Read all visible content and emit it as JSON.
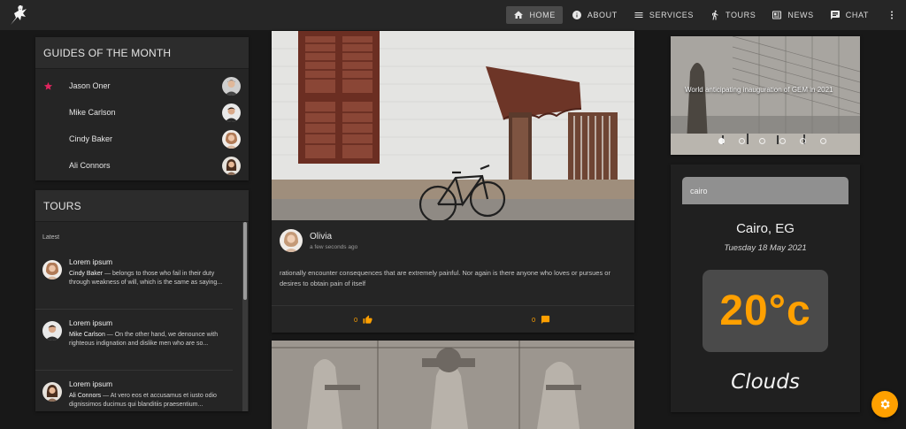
{
  "nav": {
    "items": [
      {
        "id": "home",
        "label": "HOME",
        "icon": "home-icon",
        "active": true
      },
      {
        "id": "about",
        "label": "ABOUT",
        "icon": "info-icon",
        "active": false
      },
      {
        "id": "services",
        "label": "SERVICES",
        "icon": "menu-lines-icon",
        "active": false
      },
      {
        "id": "tours",
        "label": "TOURS",
        "icon": "hiker-icon",
        "active": false
      },
      {
        "id": "news",
        "label": "NEWS",
        "icon": "newspaper-icon",
        "active": false
      },
      {
        "id": "chat",
        "label": "CHAT",
        "icon": "chat-bubble-icon",
        "active": false
      }
    ]
  },
  "guides": {
    "title": "GUIDES OF THE MONTH",
    "items": [
      {
        "name": "Jason Oner",
        "starred": true
      },
      {
        "name": "Mike Carlson",
        "starred": false
      },
      {
        "name": "Cindy Baker",
        "starred": false
      },
      {
        "name": "Ali Connors",
        "starred": false
      }
    ]
  },
  "tours": {
    "title": "TOURS",
    "subheader": "Latest",
    "items": [
      {
        "title": "Lorem ipsum",
        "author": "Cindy Baker",
        "text": " — belongs to those who fail in their duty through weakness of will, which is the same as saying..."
      },
      {
        "title": "Lorem ipsum",
        "author": "Mike Carlson",
        "text": " — On the other hand, we denounce with righteous indignation and dislike men who are so..."
      },
      {
        "title": "Lorem ipsum",
        "author": "Ali Connors",
        "text": " — At vero eos et accusamus et iusto odio dignissimos ducimus qui blanditiis praesentium..."
      }
    ]
  },
  "post": {
    "author": "Olivia",
    "time": "a few seconds ago",
    "text": "rationally encounter consequences that are extremely painful. Nor again is there anyone who loves or pursues or desires to obtain pain of itself",
    "likes": "0",
    "comments": "0"
  },
  "slider": {
    "caption": "World anticipating inauguration of GEM in 2021",
    "dot_count": 6,
    "active_dot": 0
  },
  "weather": {
    "search_value": "cairo",
    "city": "Cairo, EG",
    "date": "Tuesday 18 May 2021",
    "temperature": "20°c",
    "condition": "Clouds"
  },
  "colors": {
    "accent": "#ffa000",
    "star": "#e0245e",
    "background": "#181818",
    "card": "#252525"
  }
}
